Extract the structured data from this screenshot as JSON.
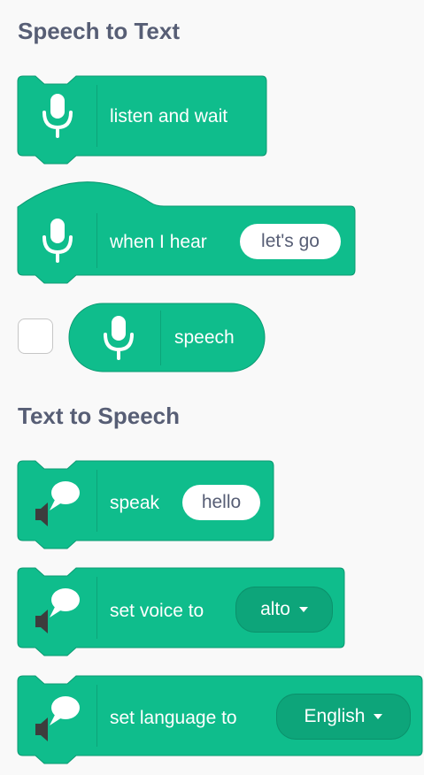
{
  "categories": {
    "speech_to_text": "Speech to Text",
    "text_to_speech": "Text to Speech"
  },
  "colors": {
    "block": "#0fbd8c",
    "block_dark": "#0da57a",
    "title": "#575e75"
  },
  "blocks": {
    "listen_and_wait": {
      "label": "listen and wait",
      "icon": "microphone-icon"
    },
    "when_i_hear": {
      "label": "when I hear",
      "input": "let's go",
      "icon": "microphone-icon"
    },
    "speech": {
      "label": "speech",
      "icon": "microphone-icon",
      "checked": false
    },
    "speak": {
      "label": "speak",
      "input": "hello",
      "icon": "speaker-speech-icon"
    },
    "set_voice": {
      "label": "set voice to",
      "value": "alto",
      "icon": "speaker-speech-icon"
    },
    "set_language": {
      "label": "set language to",
      "value": "English",
      "icon": "speaker-speech-icon"
    }
  }
}
